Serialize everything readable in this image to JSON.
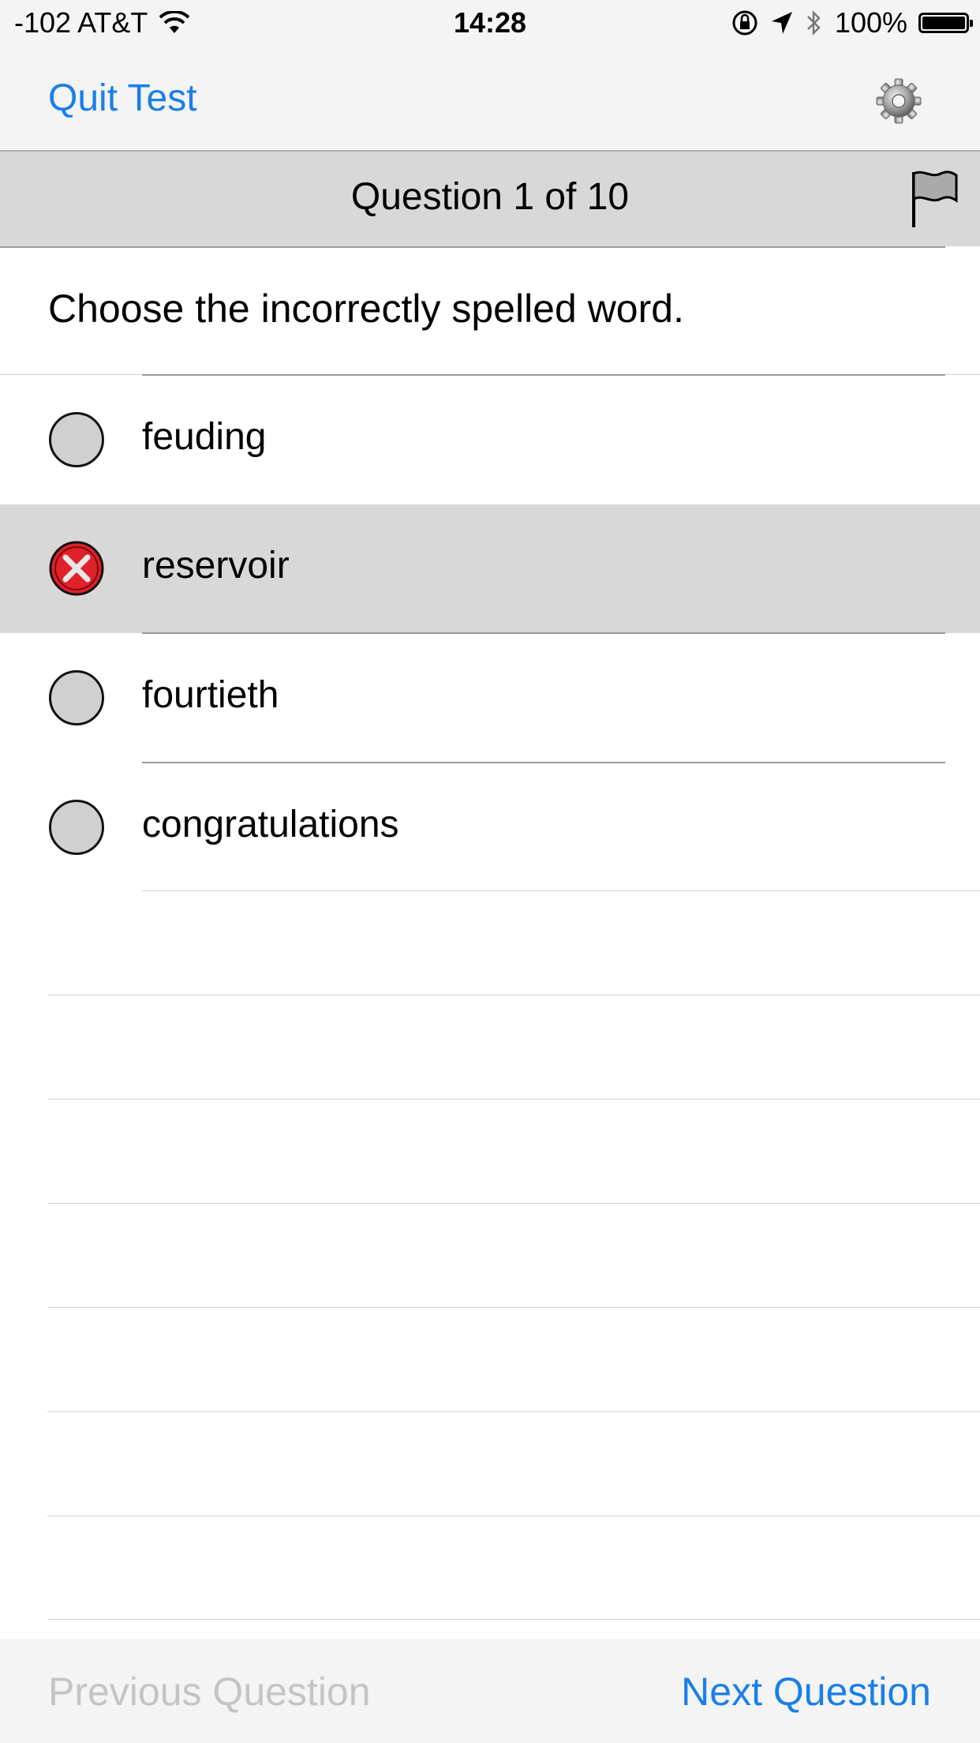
{
  "status_bar": {
    "carrier": "-102 AT&T",
    "time": "14:28",
    "battery": "100%"
  },
  "nav": {
    "quit_label": "Quit Test",
    "settings_icon": "gear-icon"
  },
  "header": {
    "counter": "Question 1 of 10",
    "flag_icon": "flag-icon"
  },
  "question": {
    "text": "Choose the incorrectly spelled word."
  },
  "answers": [
    {
      "label": "feuding",
      "state": "unselected"
    },
    {
      "label": "reservoir",
      "state": "selected-incorrect"
    },
    {
      "label": "fourtieth",
      "state": "unselected"
    },
    {
      "label": "congratulations",
      "state": "unselected"
    }
  ],
  "toolbar": {
    "previous_label": "Previous Question",
    "next_label": "Next Question"
  },
  "colors": {
    "accent": "#1a7fe8",
    "disabled": "#c4c4c4",
    "incorrect": "#e0202a",
    "selected_row": "#d8d8d8"
  }
}
